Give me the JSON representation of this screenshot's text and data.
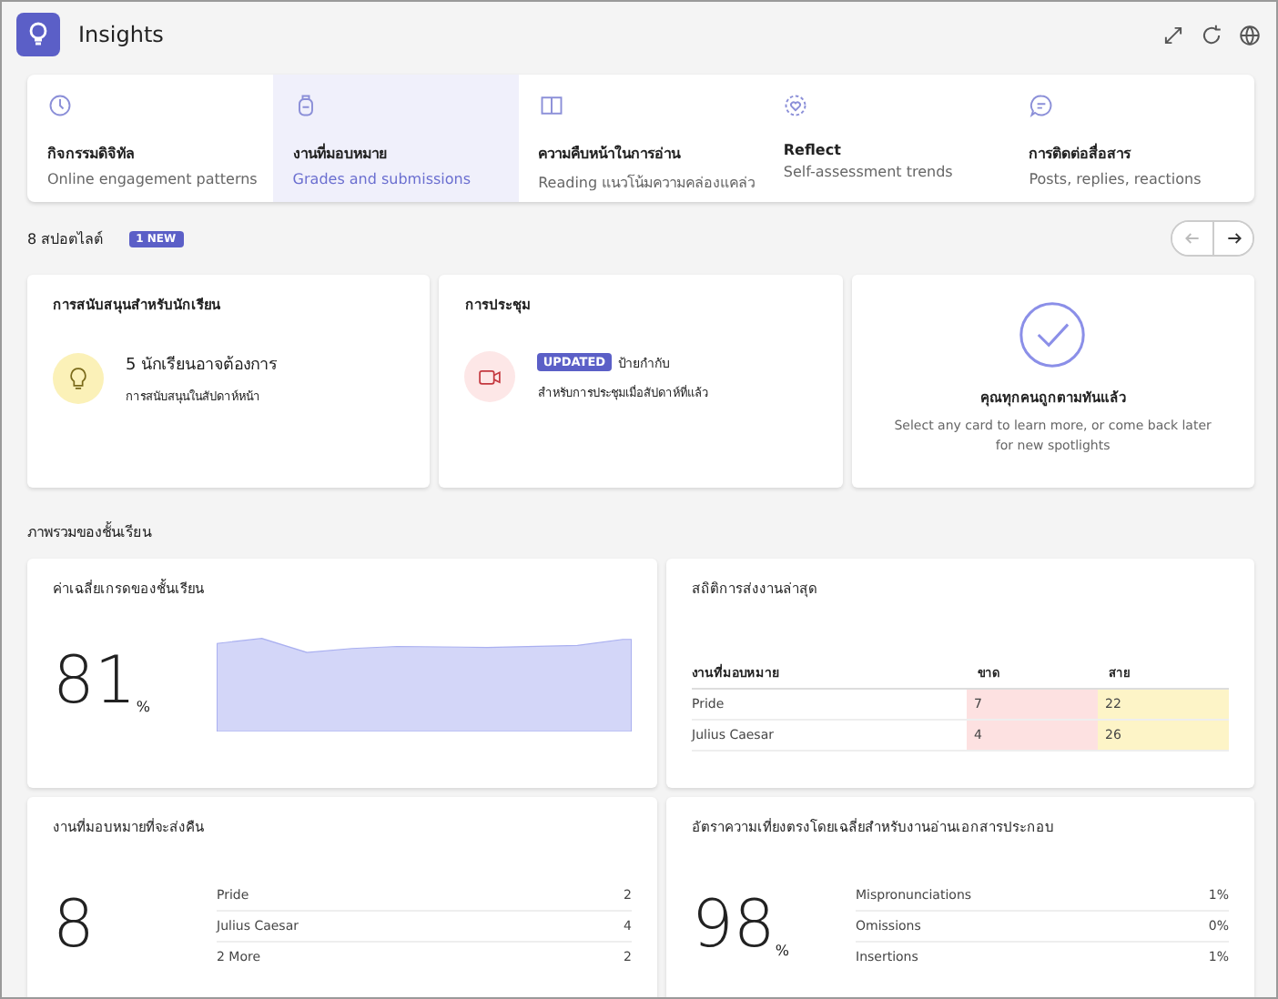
{
  "header": {
    "title": "Insights"
  },
  "tabs": [
    {
      "kind": "clock",
      "title": "กิจกรรมดิจิทัล",
      "subtitle": "Online engagement patterns",
      "selected": false
    },
    {
      "kind": "backpack",
      "title": "งานที่มอบหมาย",
      "subtitle": "Grades and submissions",
      "selected": true
    },
    {
      "kind": "book",
      "title": "ความคืบหน้าในการอ่าน",
      "subtitle": "Reading แนวโน้มความคล่องแคล่ว",
      "selected": false
    },
    {
      "kind": "heart",
      "title": "Reflect",
      "subtitle": "Self-assessment trends",
      "selected": false
    },
    {
      "kind": "chat",
      "title": "การติดต่อสื่อสาร",
      "subtitle": "Posts, replies, reactions",
      "selected": false
    }
  ],
  "spotlights": {
    "count": "8 สปอตไลต์",
    "badge": "1 NEW",
    "cards": [
      {
        "kind": "support",
        "title": "การสนับสนุนสำหรับนักเรียน",
        "line1": "5 นักเรียนอาจต้องการ",
        "line2": "การสนับสนุนในสัปดาห์หน้า"
      },
      {
        "kind": "meeting",
        "title": "การประชุม",
        "tag": "UPDATED",
        "line1": "ป้ายกำกับ",
        "line2": "สำหรับการประชุมเมื่อสัปดาห์ที่แล้ว"
      },
      {
        "kind": "done",
        "title": "คุณทุกคนถูกตามทันแล้ว",
        "line1": "Select any card to learn more, or come back later for new spotlights"
      }
    ]
  },
  "overview": {
    "title": "ภาพรวมของชั้นเรียน",
    "grade": {
      "title": "ค่าเฉลี่ยเกรดของชั้นเรียน",
      "value": "81",
      "unit": "%"
    },
    "submissions": {
      "title": "สถิติการส่งงานล่าสุด",
      "columns": [
        "งานที่มอบหมาย",
        "ขาด",
        "สาย"
      ],
      "rows": [
        [
          "Pride",
          "7",
          "22"
        ],
        [
          "Julius Caesar",
          "4",
          "26"
        ]
      ]
    },
    "returns": {
      "title": "งานที่มอบหมายที่จะส่งคืน",
      "value": "8",
      "rows": [
        [
          "Pride",
          "2"
        ],
        [
          "Julius Caesar",
          "4"
        ],
        [
          "2 More",
          "2"
        ]
      ]
    },
    "accuracy": {
      "title": "อัตราความเที่ยงตรงโดยเฉลี่ยสำหรับงานอ่านเอกสารประกอบ",
      "value": "98",
      "unit": "%",
      "rows": [
        [
          "Mispronunciations",
          "1%"
        ],
        [
          "Omissions",
          "0%"
        ],
        [
          "Insertions",
          "1%"
        ]
      ]
    }
  }
}
